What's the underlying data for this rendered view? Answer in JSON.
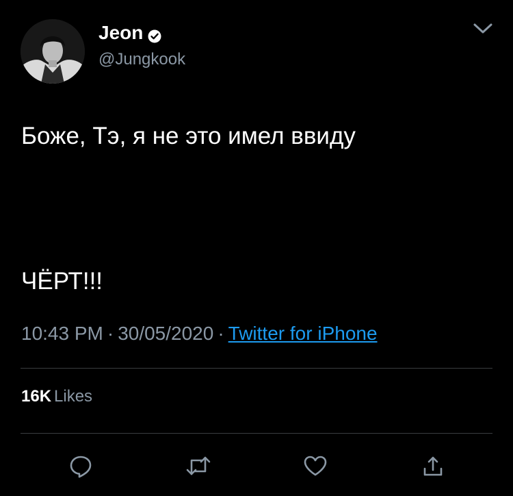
{
  "profile": {
    "display_name": "Jeon",
    "handle": "@Jungkook",
    "verified": true
  },
  "tweet": {
    "lines": [
      "Боже, Тэ, я не это имел ввиду",
      "ЧЁРТ!!!"
    ],
    "time": "10:43 PM",
    "date": "30/05/2020",
    "separator": "·",
    "source": "Twitter for iPhone"
  },
  "stats": {
    "likes_count": "16K",
    "likes_label": "Likes"
  },
  "actions": [
    {
      "name": "reply",
      "icon": "reply-icon"
    },
    {
      "name": "retweet",
      "icon": "retweet-icon"
    },
    {
      "name": "like",
      "icon": "heart-icon"
    },
    {
      "name": "share",
      "icon": "share-icon"
    }
  ],
  "colors": {
    "background": "#000000",
    "text_primary": "#ffffff",
    "text_secondary": "#8b98a5",
    "link": "#1d9bf0",
    "divider": "#3a3d40"
  }
}
